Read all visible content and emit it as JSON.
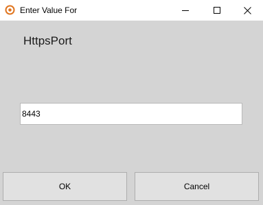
{
  "window": {
    "title": "Enter Value For",
    "icon": "target-icon"
  },
  "titlebar_buttons": {
    "minimize_icon": "minimize-icon",
    "maximize_icon": "maximize-icon",
    "close_icon": "close-icon"
  },
  "field": {
    "label": "HttpsPort",
    "value": "8443"
  },
  "buttons": {
    "ok_label": "OK",
    "cancel_label": "Cancel"
  },
  "colors": {
    "accent_icon": "#e0751f",
    "dialog_background": "#d4d4d4",
    "button_background": "#e1e1e1"
  }
}
